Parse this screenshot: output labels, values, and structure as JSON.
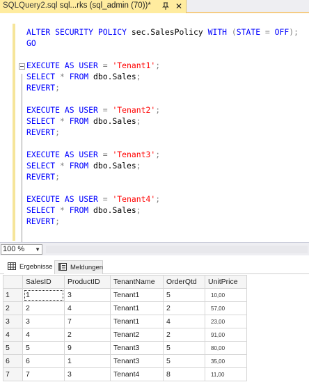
{
  "tab": {
    "prefix": "SQLQuery2.sql",
    "title": "sql...rks (sql_admin (70))*",
    "close_glyph": "✕"
  },
  "editor": {
    "lines": [
      {
        "id": "l1",
        "tokens": [
          [
            "kw",
            "ALTER SECURITY POLICY "
          ],
          [
            "",
            "sec.SalesPolicy "
          ],
          [
            "kw",
            "WITH "
          ],
          [
            "op",
            "("
          ],
          [
            "kw",
            "STATE "
          ],
          [
            "op",
            "= "
          ],
          [
            "kw",
            "OFF"
          ],
          [
            "op",
            ");"
          ]
        ]
      },
      {
        "id": "l2",
        "tokens": [
          [
            "kw",
            "GO"
          ]
        ]
      },
      {
        "id": "l3",
        "tokens": []
      },
      {
        "id": "l4",
        "tokens": [
          [
            "kw",
            "EXECUTE AS USER "
          ],
          [
            "op",
            "= "
          ],
          [
            "str",
            "'Tenant1'"
          ],
          [
            "op",
            ";"
          ]
        ]
      },
      {
        "id": "l5",
        "tokens": [
          [
            "kw",
            "SELECT "
          ],
          [
            "op",
            "* "
          ],
          [
            "kw",
            "FROM "
          ],
          [
            "",
            "dbo.Sales"
          ],
          [
            "op",
            ";"
          ]
        ]
      },
      {
        "id": "l6",
        "tokens": [
          [
            "kw",
            "REVERT"
          ],
          [
            "op",
            ";"
          ]
        ]
      },
      {
        "id": "l7",
        "tokens": []
      },
      {
        "id": "l8",
        "tokens": [
          [
            "kw",
            "EXECUTE AS USER "
          ],
          [
            "op",
            "= "
          ],
          [
            "str",
            "'Tenant2'"
          ],
          [
            "op",
            ";"
          ]
        ]
      },
      {
        "id": "l9",
        "tokens": [
          [
            "kw",
            "SELECT "
          ],
          [
            "op",
            "* "
          ],
          [
            "kw",
            "FROM "
          ],
          [
            "",
            "dbo.Sales"
          ],
          [
            "op",
            ";"
          ]
        ]
      },
      {
        "id": "l10",
        "tokens": [
          [
            "kw",
            "REVERT"
          ],
          [
            "op",
            ";"
          ]
        ]
      },
      {
        "id": "l11",
        "tokens": []
      },
      {
        "id": "l12",
        "tokens": [
          [
            "kw",
            "EXECUTE AS USER "
          ],
          [
            "op",
            "= "
          ],
          [
            "str",
            "'Tenant3'"
          ],
          [
            "op",
            ";"
          ]
        ]
      },
      {
        "id": "l13",
        "tokens": [
          [
            "kw",
            "SELECT "
          ],
          [
            "op",
            "* "
          ],
          [
            "kw",
            "FROM "
          ],
          [
            "",
            "dbo.Sales"
          ],
          [
            "op",
            ";"
          ]
        ]
      },
      {
        "id": "l14",
        "tokens": [
          [
            "kw",
            "REVERT"
          ],
          [
            "op",
            ";"
          ]
        ]
      },
      {
        "id": "l15",
        "tokens": []
      },
      {
        "id": "l16",
        "tokens": [
          [
            "kw",
            "EXECUTE AS USER "
          ],
          [
            "op",
            "= "
          ],
          [
            "str",
            "'Tenant4'"
          ],
          [
            "op",
            ";"
          ]
        ]
      },
      {
        "id": "l17",
        "tokens": [
          [
            "kw",
            "SELECT "
          ],
          [
            "op",
            "* "
          ],
          [
            "kw",
            "FROM "
          ],
          [
            "",
            "dbo.Sales"
          ],
          [
            "op",
            ";"
          ]
        ]
      },
      {
        "id": "l18",
        "tokens": [
          [
            "kw",
            "REVERT"
          ],
          [
            "op",
            ";"
          ]
        ]
      }
    ]
  },
  "zoom": {
    "value": "100 %",
    "arrow": "▼"
  },
  "results_tabs": {
    "results_label": "Ergebnisse",
    "messages_label": "Meldungen"
  },
  "grid": {
    "columns": [
      "SalesID",
      "ProductID",
      "TenantName",
      "OrderQtd",
      "UnitPrice"
    ],
    "rows": [
      {
        "rh": "1",
        "cells": [
          "1",
          "3",
          "Tenant1",
          "5",
          "10,00"
        ]
      },
      {
        "rh": "2",
        "cells": [
          "2",
          "4",
          "Tenant1",
          "2",
          "57,00"
        ]
      },
      {
        "rh": "3",
        "cells": [
          "3",
          "7",
          "Tenant1",
          "4",
          "23,00"
        ]
      },
      {
        "rh": "4",
        "cells": [
          "4",
          "2",
          "Tenant2",
          "2",
          "91,00"
        ]
      },
      {
        "rh": "5",
        "cells": [
          "5",
          "9",
          "Tenant3",
          "5",
          "80,00"
        ]
      },
      {
        "rh": "6",
        "cells": [
          "6",
          "1",
          "Tenant3",
          "5",
          "35,00"
        ]
      },
      {
        "rh": "7",
        "cells": [
          "7",
          "3",
          "Tenant4",
          "8",
          "11,00"
        ]
      }
    ]
  },
  "colors": {
    "keyword": "#0000ff",
    "string": "#ff0000",
    "operator": "#808080",
    "tab_active": "#ffec9f"
  }
}
